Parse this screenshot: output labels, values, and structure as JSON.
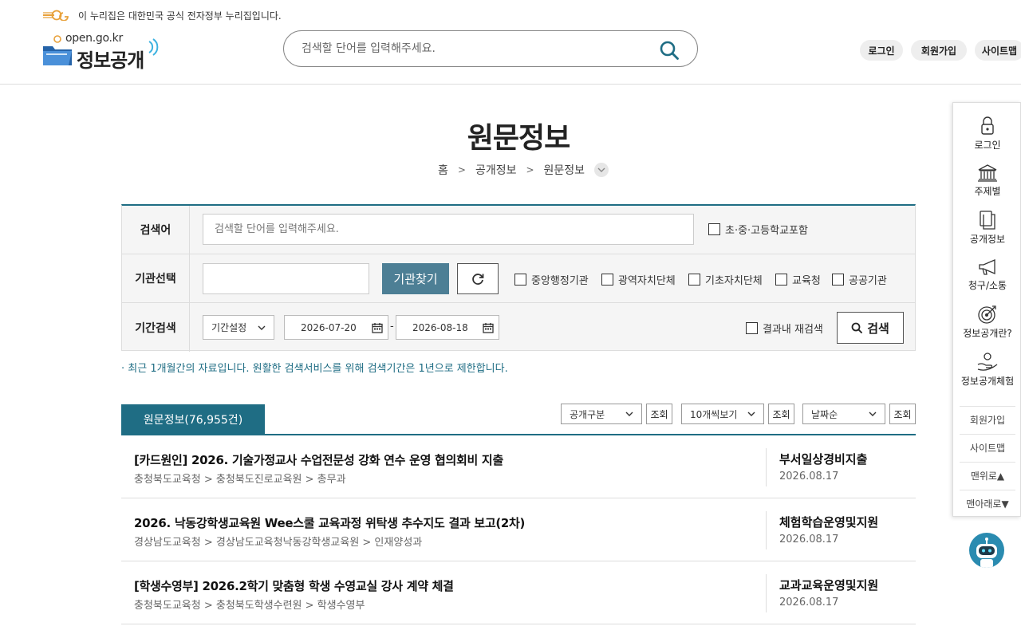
{
  "header": {
    "gov_banner": "이 누리집은 대한민국 공식 전자정부 누리집입니다.",
    "logo_url": "open.go.kr",
    "logo_name": "정보공개",
    "search_placeholder": "검색할 단어를 입력해주세요.",
    "links": [
      "로그인",
      "회원가입",
      "사이트맵"
    ]
  },
  "page": {
    "title": "원문정보",
    "breadcrumb": [
      "홈",
      "공개정보",
      "원문정보"
    ]
  },
  "form": {
    "keyword_label": "검색어",
    "keyword_placeholder": "검색할 단어를 입력해주세요.",
    "school_checkbox": "초·중·고등학교포함",
    "org_label": "기관선택",
    "org_value": "",
    "find_org_button": "기관찾기",
    "org_types": [
      "중앙행정기관",
      "광역자치단체",
      "기초자치단체",
      "교육청",
      "공공기관"
    ],
    "period_label": "기간검색",
    "period_select": "기간설정",
    "date_from": "2026-07-20",
    "date_to": "2026-08-18",
    "date_sep": "-",
    "research_checkbox": "결과내 재검색",
    "search_button": "검색"
  },
  "notice": "· 최근 1개월간의 자료입니다. 원활한 검색서비스를 위해 검색기간은 1년으로 제한합니다.",
  "results_header": {
    "tab_label": "원문정보(76,955건)",
    "filter_open_type": "공개구분",
    "filter_page_size": "10개씩보기",
    "filter_sort": "날짜순",
    "view_button": "조회"
  },
  "results": [
    {
      "title": "[카드원인] 2026. 기술가정교사 수업전문성 강화 연수 운영 협의회비 지출",
      "path": "충청북도교육청 > 충청북도진로교육원 > 총무과",
      "category": "부서일상경비지출",
      "date": "2026.08.17"
    },
    {
      "title": "2026. 낙동강학생교육원 Wee스쿨 교육과정 위탁생 추수지도 결과 보고(2차)",
      "path": "경상남도교육청 > 경상남도교육청낙동강학생교육원 > 인재양성과",
      "category": "체험학습운영및지원",
      "date": "2026.08.17"
    },
    {
      "title": "[학생수영부] 2026.2학기 맞춤형 학생 수영교실 강사 계약 체결",
      "path": "충청북도교육청 > 충청북도학생수련원 > 학생수영부",
      "category": "교과교육운영및지원",
      "date": "2026.08.17"
    }
  ],
  "quick_menu": {
    "items": [
      "로그인",
      "주제별",
      "공개정보",
      "청구/소통",
      "정보공개란?",
      "정보공개체험"
    ],
    "sub_links": [
      "회원가입",
      "사이트맵",
      "맨위로▲",
      "맨아래로▼"
    ]
  }
}
